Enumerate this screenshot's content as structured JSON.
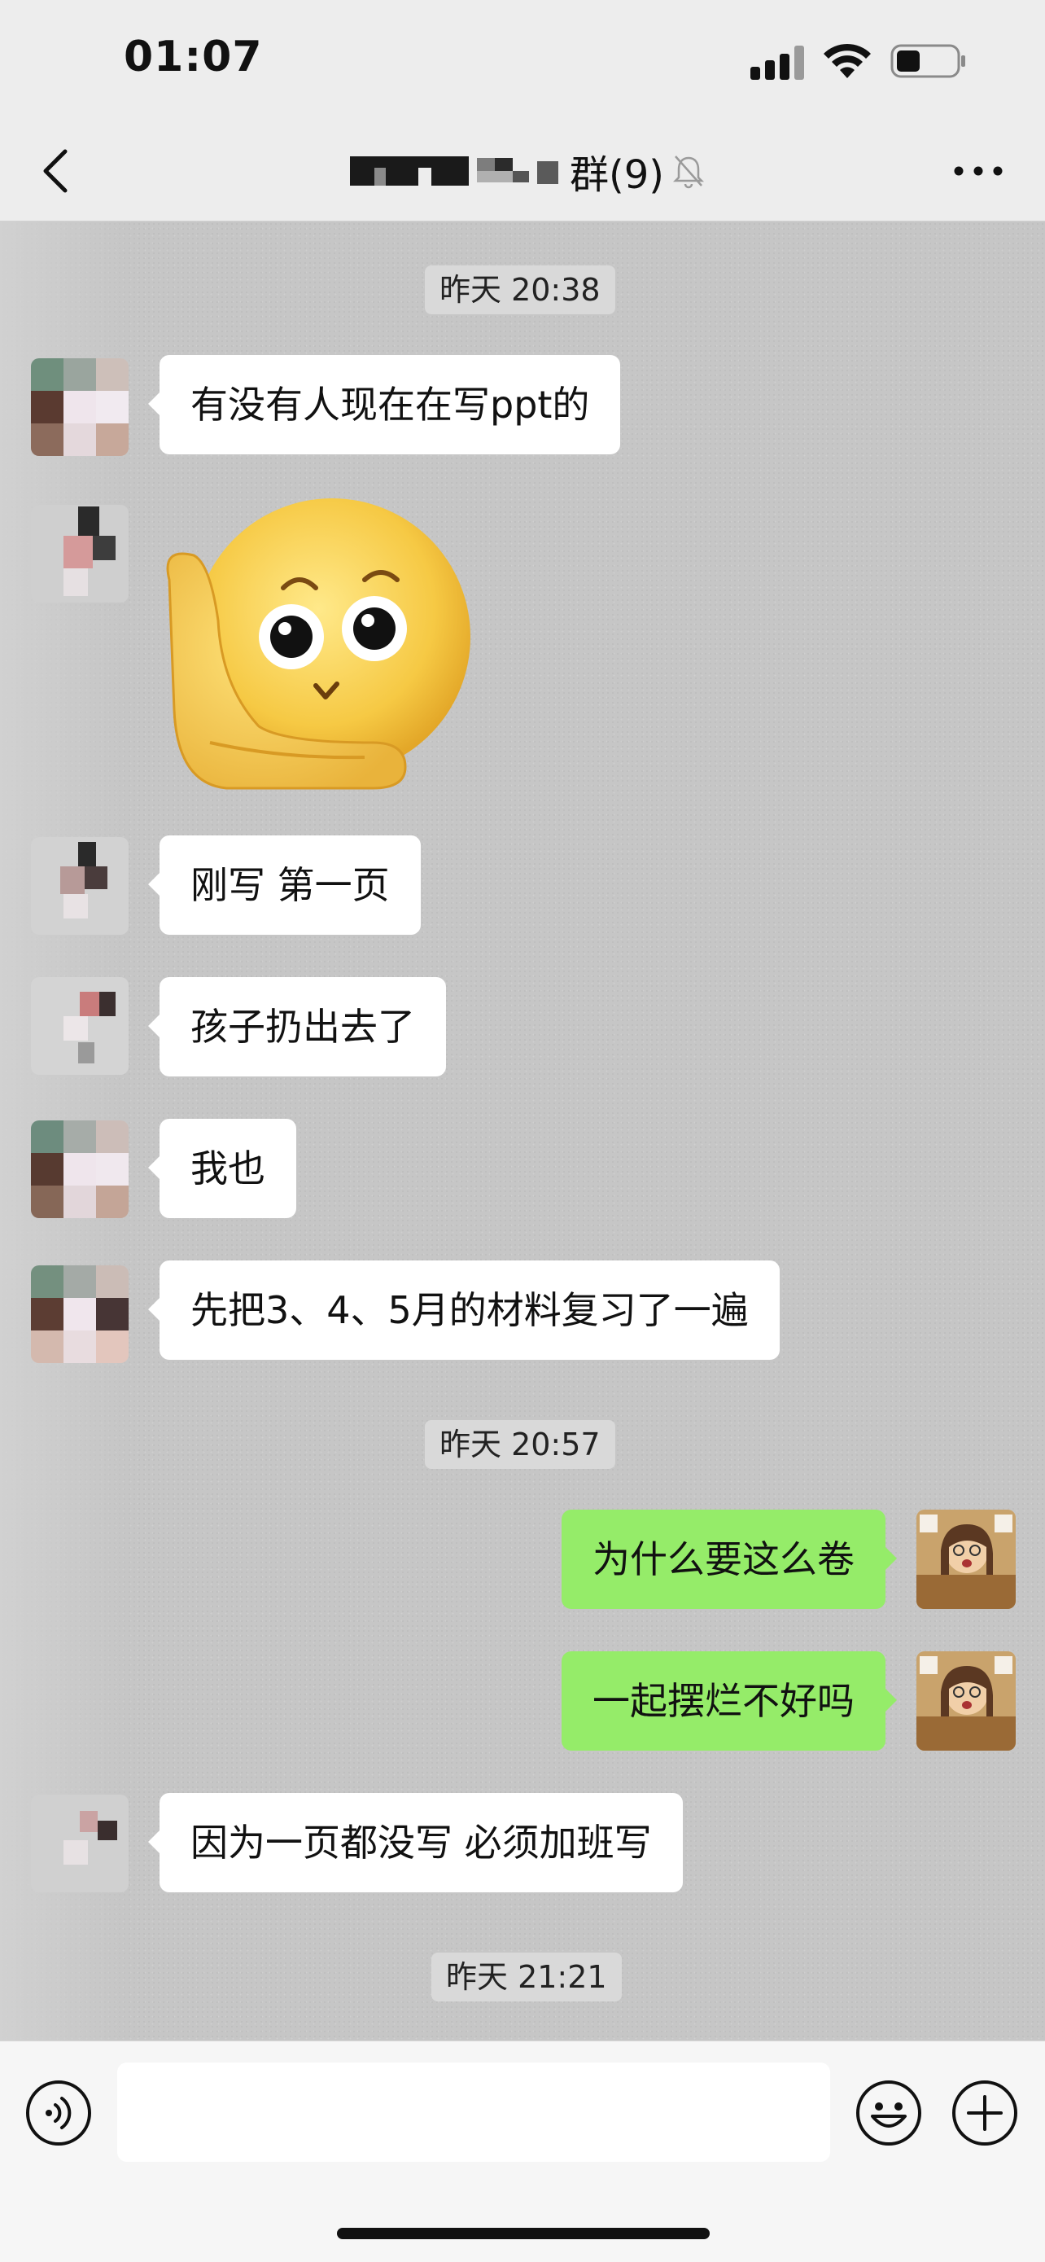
{
  "status_bar": {
    "time": "01:07",
    "signal_bars": 3,
    "battery_level": 0.35
  },
  "nav": {
    "title": "群(9)",
    "title_obscured": true,
    "muted": true
  },
  "messages": [
    {
      "type": "timestamp",
      "text": "昨天 20:38"
    },
    {
      "type": "text",
      "direction": "incoming",
      "text": "有没有人现在在写ppt的"
    },
    {
      "type": "sticker",
      "direction": "incoming",
      "sticker": "hand-on-cheek-face-emoji"
    },
    {
      "type": "text",
      "direction": "incoming",
      "text": "刚写 第一页"
    },
    {
      "type": "text",
      "direction": "incoming",
      "text": "孩子扔出去了"
    },
    {
      "type": "text",
      "direction": "incoming",
      "text": "我也"
    },
    {
      "type": "text",
      "direction": "incoming",
      "text": "先把3、4、5月的材料复习了一遍"
    },
    {
      "type": "timestamp",
      "text": "昨天 20:57"
    },
    {
      "type": "text",
      "direction": "outgoing",
      "text": "为什么要这么卷"
    },
    {
      "type": "text",
      "direction": "outgoing",
      "text": "一起摆烂不好吗"
    },
    {
      "type": "text",
      "direction": "incoming",
      "text": "因为一页都没写   必须加班写"
    },
    {
      "type": "timestamp",
      "text": "昨天 21:21"
    }
  ],
  "input": {
    "value": "",
    "placeholder": ""
  },
  "icons": {
    "back": "chevron-left-icon",
    "more": "more-dots-icon",
    "voice": "voice-icon",
    "emoji": "emoji-icon",
    "plus": "plus-icon",
    "mute": "bell-off-icon"
  },
  "colors": {
    "chat_background": "#c6c6c6",
    "outgoing_bubble": "#95ec69",
    "incoming_bubble": "#ffffff",
    "bar_background": "#ededed"
  }
}
